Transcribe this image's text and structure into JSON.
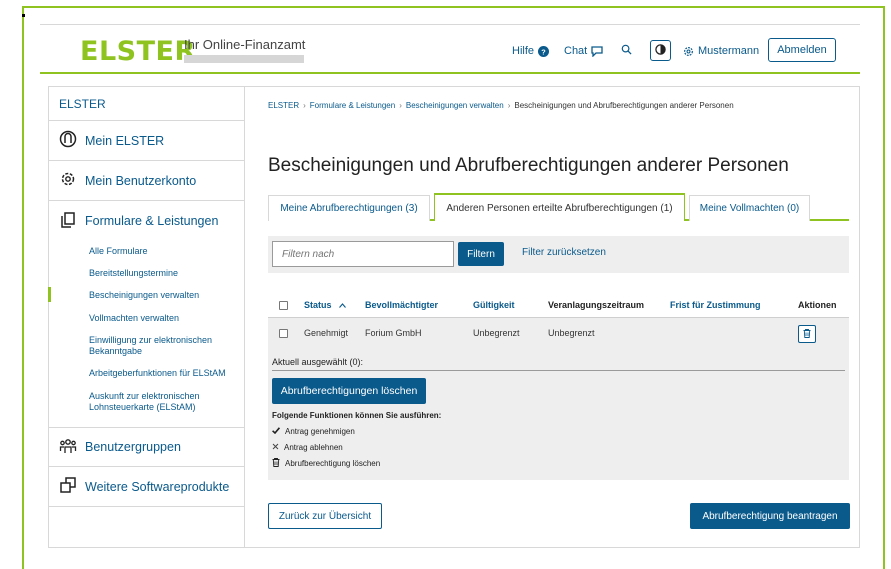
{
  "header": {
    "logo": "ELSTER",
    "tagline": "Ihr Online-Finanzamt",
    "help": "Hilfe",
    "chat": "Chat",
    "user": "Mustermann",
    "logout": "Abmelden"
  },
  "sidebar": {
    "title": "ELSTER",
    "main_items": [
      {
        "label": "Mein ELSTER",
        "icon": "elster-circle-icon"
      },
      {
        "label": "Mein Benutzerkonto",
        "icon": "gear-icon"
      },
      {
        "label": "Formulare & Leistungen",
        "icon": "copy-documents-icon"
      },
      {
        "label": "Benutzergruppen",
        "icon": "user-group-icon"
      },
      {
        "label": "Weitere Softwareprodukte",
        "icon": "software-icon"
      }
    ],
    "sub_items": [
      "Alle Formulare",
      "Bereitstellungstermine",
      "Bescheinigungen verwalten",
      "Vollmachten verwalten",
      "Einwilligung zur elektronischen Bekanntgabe",
      "Arbeitgeberfunktionen für ELStAM",
      "Auskunft zur elektronischen Lohnsteuerkarte (ELStAM)"
    ],
    "active_sub_item": "Bescheinigungen verwalten"
  },
  "breadcrumb": [
    "ELSTER",
    "Formulare & Leistungen",
    "Bescheinigungen verwalten",
    "Bescheinigungen und Abrufberechtigungen anderer Personen"
  ],
  "page_title": "Bescheinigungen und Abrufberechtigungen anderer Personen",
  "tabs": [
    {
      "label": "Meine Abrufberechtigungen (3)",
      "active": false
    },
    {
      "label": "Anderen Personen erteilte Abrufberechtigungen (1)",
      "active": true
    },
    {
      "label": "Meine Vollmachten (0)",
      "active": false
    }
  ],
  "filter": {
    "placeholder": "Filtern nach",
    "button": "Filtern",
    "reset": "Filter zurücksetzen"
  },
  "table": {
    "columns": [
      "Status",
      "Bevollmächtigter",
      "Gültigkeit",
      "Veranlagungszeitraum",
      "Frist für Zustimmung",
      "Aktionen"
    ],
    "sort_indicator": "^",
    "rows": [
      {
        "status": "Genehmigt",
        "bevollmaechtigter": "Forium GmbH",
        "gueltigkeit": "Unbegrenzt",
        "zeitraum": "Unbegrenzt",
        "frist": ""
      }
    ]
  },
  "selection": {
    "label": "Aktuell ausgewählt (0):",
    "delete_button": "Abrufberechtigungen löschen",
    "functions_title": "Folgende Funktionen können Sie ausführen:",
    "functions": [
      {
        "label": "Antrag genehmigen",
        "icon": "check-icon"
      },
      {
        "label": "Antrag ablehnen",
        "icon": "x-icon"
      },
      {
        "label": "Abrufberechtigung löschen",
        "icon": "trash-icon"
      }
    ]
  },
  "footer": {
    "back": "Zurück zur Übersicht",
    "request": "Abrufberechtigung beantragen"
  },
  "colors": {
    "brand_green": "#8fc31f",
    "link_blue": "#0a5a8c",
    "panel_gray": "#eeeeee"
  }
}
